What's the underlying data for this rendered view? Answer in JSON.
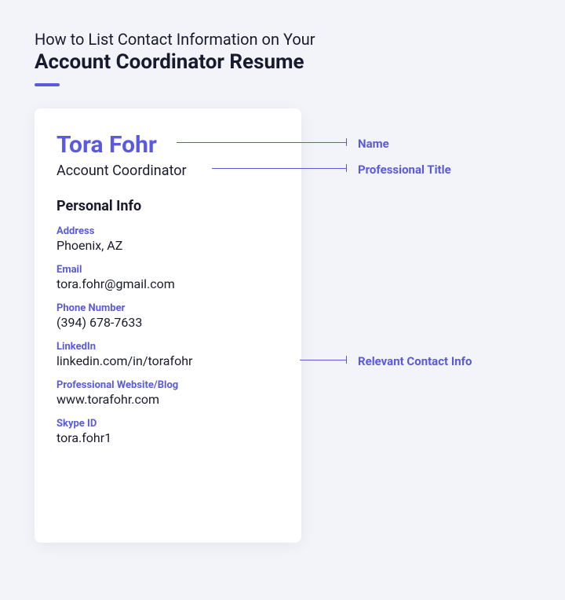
{
  "header": {
    "line1": "How to List Contact Information on Your",
    "line2": "Account Coordinator Resume"
  },
  "card": {
    "name": "Tora Fohr",
    "title": "Account Coordinator",
    "section_header": "Personal Info",
    "info": [
      {
        "label": "Address",
        "value": "Phoenix, AZ"
      },
      {
        "label": "Email",
        "value": "tora.fohr@gmail.com"
      },
      {
        "label": "Phone Number",
        "value": "(394) 678-7633"
      },
      {
        "label": "LinkedIn",
        "value": "linkedin.com/in/torafohr"
      },
      {
        "label": "Professional Website/Blog",
        "value": "www.torafohr.com"
      },
      {
        "label": "Skype ID",
        "value": "tora.fohr1"
      }
    ]
  },
  "annotations": {
    "name": "Name",
    "title": "Professional Title",
    "contact": "Relevant Contact Info"
  }
}
